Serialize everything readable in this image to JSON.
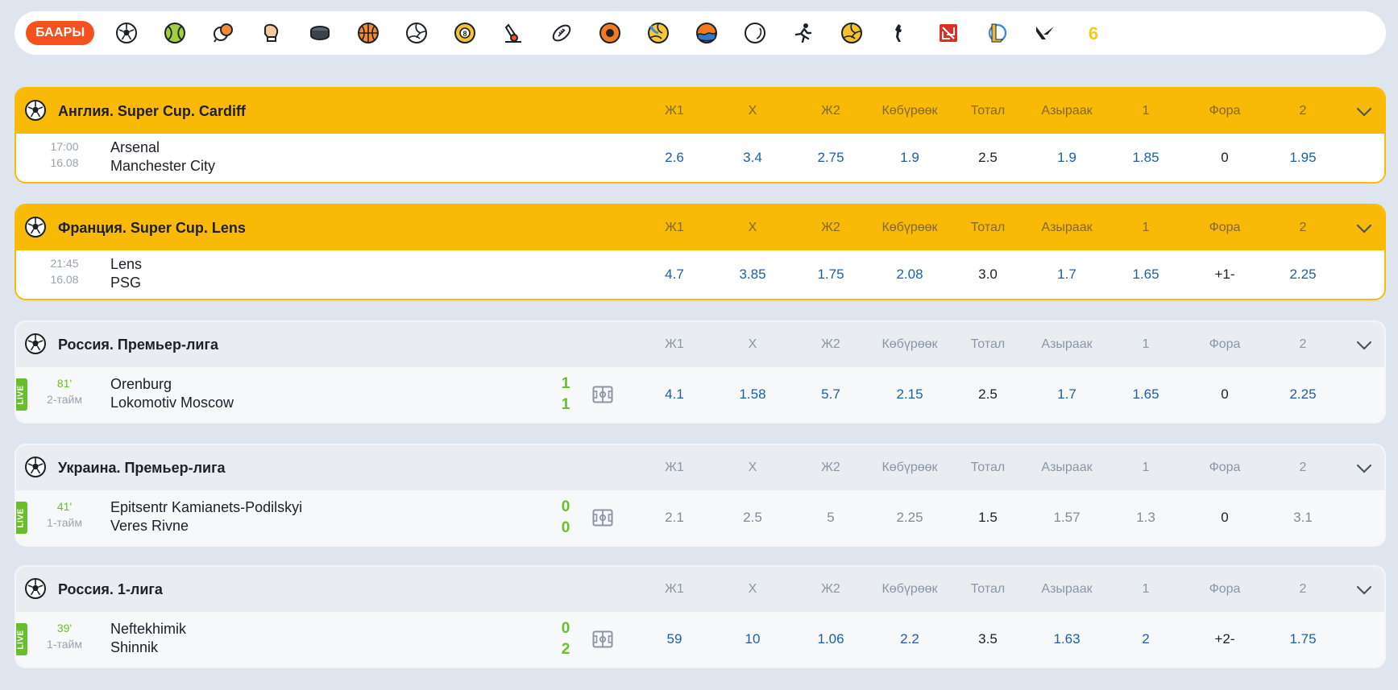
{
  "sports_bar": {
    "all_label": "БААРЫ",
    "icons": [
      "soccer-ball-icon",
      "tennis-ball-icon",
      "table-tennis-icon",
      "boxing-glove-icon",
      "hockey-puck-icon",
      "basketball-icon",
      "volleyball-icon",
      "billiards-icon",
      "badminton-icon",
      "american-football-icon",
      "handball-icon",
      "beach-volleyball-icon",
      "water-polo-icon",
      "golf-ball-icon",
      "athletics-icon",
      "futsal-icon",
      "counter-strike-icon",
      "dota2-icon",
      "league-of-legends-icon",
      "valorant-icon",
      "rainbow-six-icon"
    ]
  },
  "odds_headers": [
    "Ж1",
    "Х",
    "Ж2",
    "Көбүрөөк",
    "Тотал",
    "Азыраак",
    "1",
    "Фора",
    "2"
  ],
  "leagues": [
    {
      "name": "Англия. Super Cup. Cardiff",
      "style": "featured",
      "match": {
        "time": "17:00",
        "date": "16.08",
        "team1": "Arsenal",
        "team2": "Manchester City",
        "live": false,
        "odds": [
          "2.6",
          "3.4",
          "2.75",
          "1.9",
          "2.5",
          "1.9",
          "1.85",
          "0",
          "1.95"
        ]
      }
    },
    {
      "name": "Франция. Super Cup. Lens",
      "style": "featured",
      "match": {
        "time": "21:45",
        "date": "16.08",
        "team1": "Lens",
        "team2": "PSG",
        "live": false,
        "odds": [
          "4.7",
          "3.85",
          "1.75",
          "2.08",
          "3.0",
          "1.7",
          "1.65",
          "+1-",
          "2.25"
        ]
      }
    },
    {
      "name": "Россия. Премьер-лига",
      "style": "regular",
      "match": {
        "time": "81'",
        "date": "2-тайм",
        "team1": "Orenburg",
        "team2": "Lokomotiv Moscow",
        "live": true,
        "live_label": "LIVE",
        "score1": "1",
        "score2": "1",
        "odds": [
          "4.1",
          "1.58",
          "5.7",
          "2.15",
          "2.5",
          "1.7",
          "1.65",
          "0",
          "2.25"
        ]
      }
    },
    {
      "name": "Украина. Премьер-лига",
      "style": "regular",
      "match": {
        "time": "41'",
        "date": "1-тайм",
        "team1": "Epitsentr Kamianets-Podilskyi",
        "team2": "Veres Rivne",
        "live": true,
        "live_label": "LIVE",
        "score1": "0",
        "score2": "0",
        "odds_muted": true,
        "odds": [
          "2.1",
          "2.5",
          "5",
          "2.25",
          "1.5",
          "1.57",
          "1.3",
          "0",
          "3.1"
        ]
      }
    },
    {
      "name": "Россия. 1-лига",
      "style": "regular",
      "match": {
        "time": "39'",
        "date": "1-тайм",
        "team1": "Neftekhimik",
        "team2": "Shinnik",
        "live": true,
        "live_label": "LIVE",
        "score1": "0",
        "score2": "2",
        "odds": [
          "59",
          "10",
          "1.06",
          "2.2",
          "3.5",
          "1.63",
          "2",
          "+2-",
          "1.75"
        ]
      }
    }
  ],
  "colors": {
    "accent_orange": "#f5511d",
    "featured_yellow": "#f9b907",
    "live_green": "#6cbd2e",
    "odds_blue": "#1c5fa8"
  }
}
